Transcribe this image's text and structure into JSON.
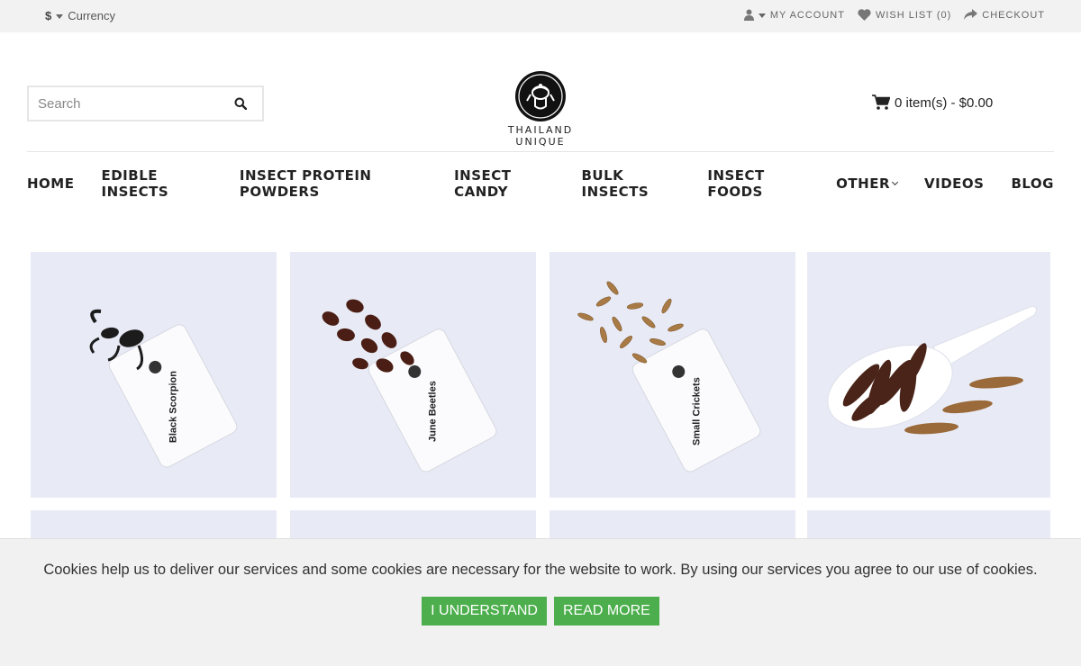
{
  "topbar": {
    "currency_symbol": "$",
    "currency_label": "Currency",
    "links": [
      {
        "icon": "user-icon",
        "label": "My Account"
      },
      {
        "icon": "heart-icon",
        "label": "Wish List (0)"
      },
      {
        "icon": "share-icon",
        "label": "Checkout"
      }
    ]
  },
  "header": {
    "search_placeholder": "Search",
    "logo_text": "THAILAND UNIQUE",
    "cart_label": "0 item(s) - $0.00"
  },
  "nav": {
    "items": [
      {
        "label": "HOME",
        "dropdown": false
      },
      {
        "label": "EDIBLE INSECTS",
        "dropdown": false
      },
      {
        "label": "INSECT PROTEIN POWDERS",
        "dropdown": false
      },
      {
        "label": "INSECT CANDY",
        "dropdown": false
      },
      {
        "label": "BULK INSECTS",
        "dropdown": false
      },
      {
        "label": "INSECT FOODS",
        "dropdown": false
      },
      {
        "label": "OTHER",
        "dropdown": true
      },
      {
        "label": "VIDEOS",
        "dropdown": false
      },
      {
        "label": "BLOG",
        "dropdown": false
      }
    ]
  },
  "products": [
    {
      "pack_label": "Black Scorpion"
    },
    {
      "pack_label": "June Beetles"
    },
    {
      "pack_label": "Small Crickets"
    },
    {
      "pack_label": ""
    }
  ],
  "cookie": {
    "text": "Cookies help us to deliver our services and some cookies are necessary for the website to work. By using our services you agree to our use of cookies.",
    "accept_label": "I UNDERSTAND",
    "more_label": "READ MORE"
  },
  "colors": {
    "accent_green": "#4cae4c",
    "topbar_bg": "#f2f2f2",
    "product_bg": "#e8ebf6"
  }
}
